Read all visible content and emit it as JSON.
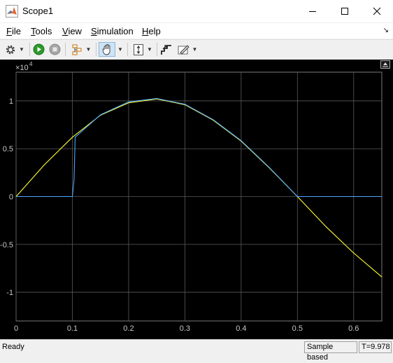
{
  "window": {
    "title": "Scope1",
    "controls": [
      "minimize-icon",
      "maximize-icon",
      "close-icon"
    ]
  },
  "menu": {
    "items": [
      {
        "first": "F",
        "rest": "ile"
      },
      {
        "first": "T",
        "rest": "ools"
      },
      {
        "first": "V",
        "rest": "iew"
      },
      {
        "first": "S",
        "rest": "imulation"
      },
      {
        "first": "H",
        "rest": "elp"
      }
    ]
  },
  "toolbar": {
    "icons": [
      "gear-icon",
      "run-icon",
      "stop-icon",
      "signal-selector-icon",
      "pan-hand-icon",
      "zoom-y-icon",
      "autoscale-icon",
      "style-icon"
    ]
  },
  "axes": {
    "exponent_label": "×10",
    "exponent_power": "4",
    "y_ticks": [
      "1",
      "0.5",
      "0",
      "-0.5",
      "-1"
    ],
    "x_ticks": [
      "0",
      "0.1",
      "0.2",
      "0.3",
      "0.4",
      "0.5",
      "0.6"
    ]
  },
  "status": {
    "ready": "Ready",
    "mode": "Sample based",
    "time": "T=9.978"
  },
  "colors": {
    "yellow_trace": "#ffff33",
    "blue_trace": "#4da6ff",
    "grid": "#5a5a5a",
    "axis_text": "#c8c8c8"
  },
  "chart_data": {
    "type": "line",
    "xlim": [
      0,
      0.65
    ],
    "ylim": [
      -13000,
      13000
    ],
    "grid": true,
    "series": [
      {
        "color": "yellow",
        "x": [
          0,
          0.05,
          0.1,
          0.15,
          0.2,
          0.25,
          0.3,
          0.35,
          0.4,
          0.45,
          0.5,
          0.55,
          0.6,
          0.65
        ],
        "y": [
          0,
          3300,
          6200,
          8500,
          9800,
          10200,
          9600,
          8000,
          5800,
          3000,
          0,
          -3100,
          -5900,
          -8400
        ]
      },
      {
        "color": "blue",
        "x": [
          0,
          0.1,
          0.1,
          0.103,
          0.105,
          0.15,
          0.2,
          0.25,
          0.3,
          0.35,
          0.4,
          0.45,
          0.5,
          0.5,
          0.65
        ],
        "y": [
          0,
          0,
          0,
          1800,
          6200,
          8550,
          9900,
          10250,
          9650,
          8050,
          5850,
          3050,
          0,
          0,
          0
        ]
      }
    ]
  }
}
